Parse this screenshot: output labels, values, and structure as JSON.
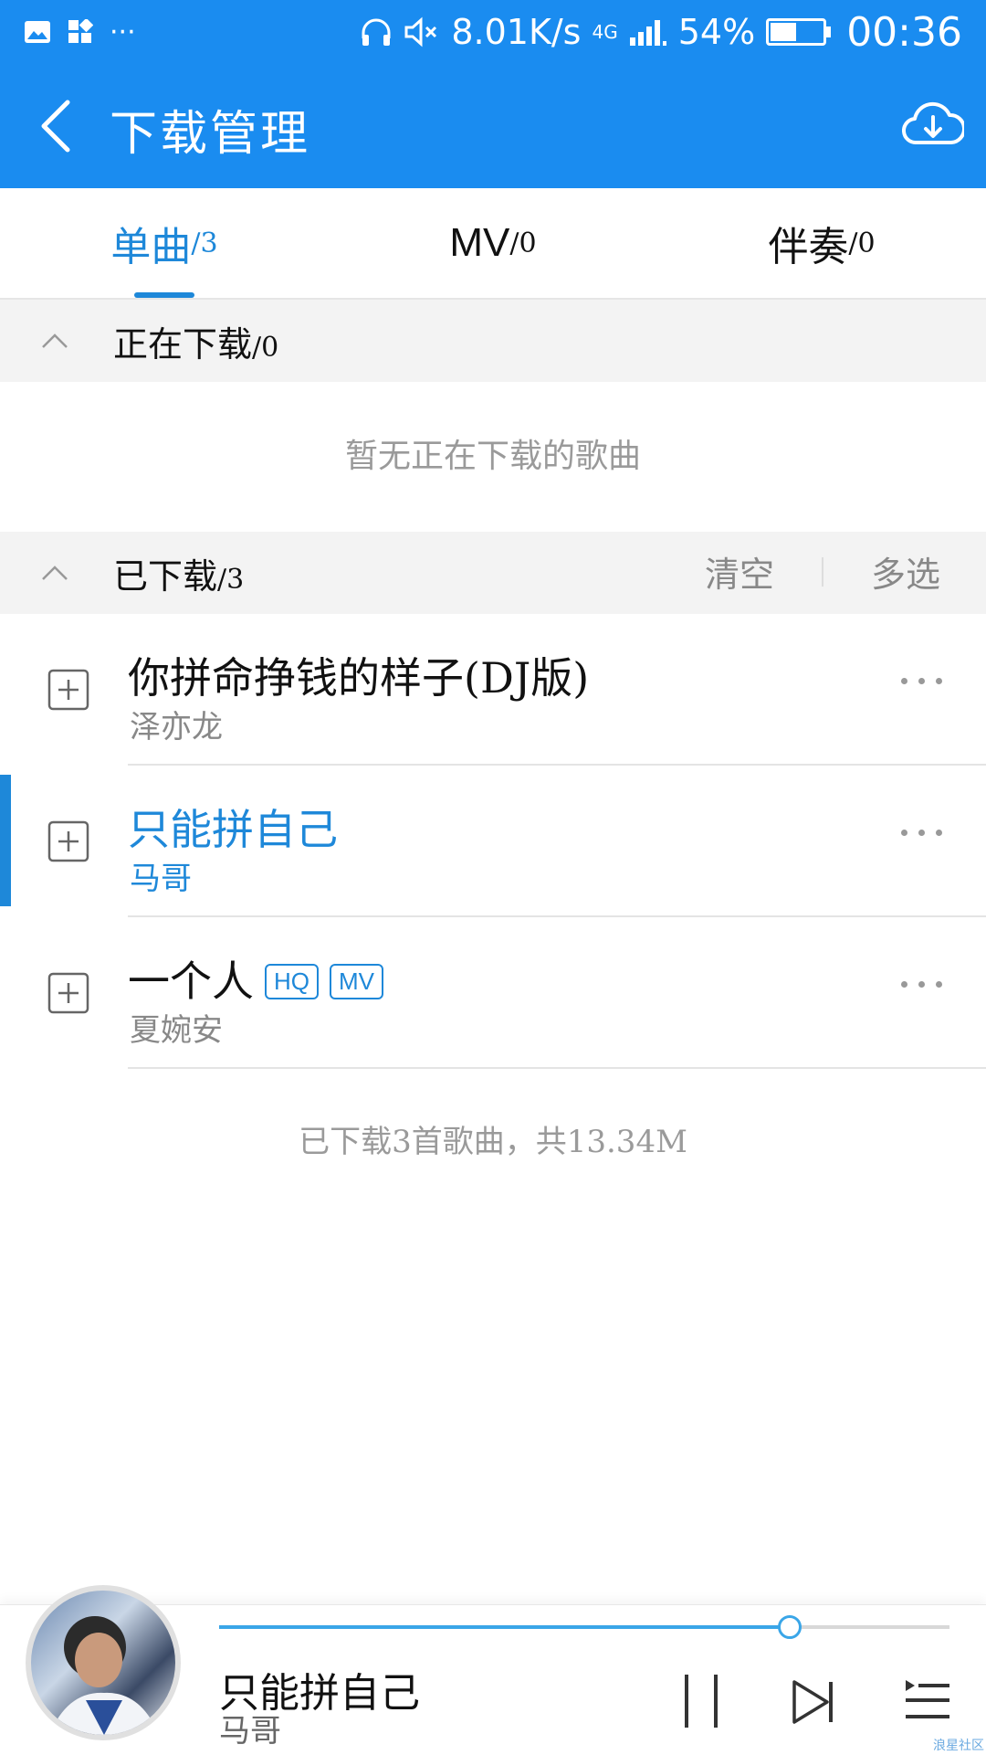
{
  "status_bar": {
    "network_speed": "8.01K/s",
    "network_type": "4G",
    "battery": "54%",
    "time": "00:36",
    "more": "···",
    "icons": [
      "image-icon",
      "app-icon",
      "headphones-icon",
      "mute-icon",
      "signal-icon",
      "battery-icon"
    ]
  },
  "app_bar": {
    "title": "下载管理",
    "back_icon": "chevron-left-icon",
    "action_icon": "cloud-download-icon"
  },
  "tabs": [
    {
      "label": "单曲",
      "count": "/3",
      "selected": true
    },
    {
      "label": "MV",
      "count": "/0",
      "selected": false
    },
    {
      "label": "伴奏",
      "count": "/0",
      "selected": false
    }
  ],
  "downloading": {
    "title": "正在下载",
    "count": "/0",
    "empty_text": "暂无正在下载的歌曲"
  },
  "downloaded": {
    "title": "已下载",
    "count": "/3",
    "clear_label": "清空",
    "multi_select_label": "多选",
    "songs": [
      {
        "title": "你拼命挣钱的样子(DJ版)",
        "artist": "泽亦龙",
        "badges": [],
        "playing": false
      },
      {
        "title": "只能拼自己",
        "artist": "马哥",
        "badges": [],
        "playing": true
      },
      {
        "title": "一个人",
        "artist": "夏婉安",
        "badges": [
          "HQ",
          "MV"
        ],
        "playing": false
      }
    ],
    "summary": "已下载3首歌曲，共13.34M"
  },
  "player": {
    "title": "只能拼自己",
    "artist": "马哥",
    "progress": 0.78,
    "accent": "#3aa6e8"
  },
  "colors": {
    "header": "#1a8cf0",
    "accent": "#1e88d9"
  },
  "watermark": "浪星社区"
}
